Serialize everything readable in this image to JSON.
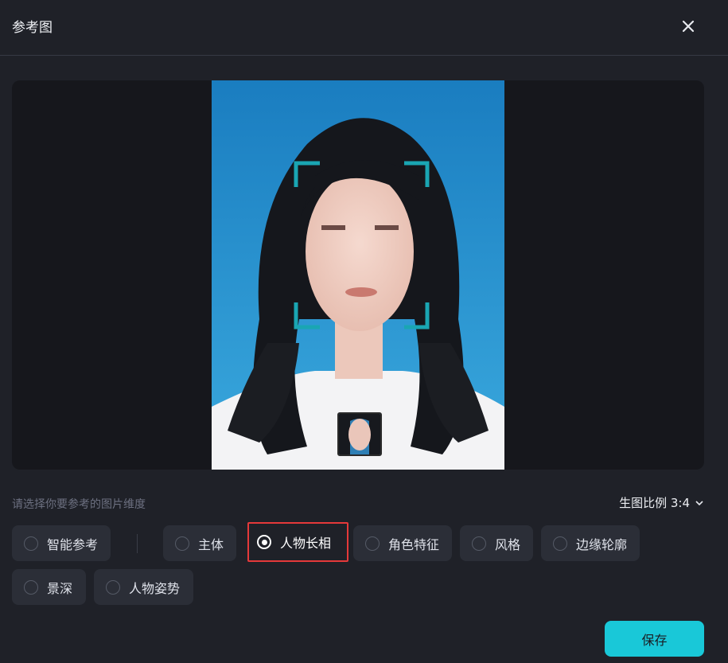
{
  "header": {
    "title": "参考图",
    "close_icon": "close-icon"
  },
  "hint": "请选择你要参考的图片维度",
  "ratio": {
    "label": "生图比例 3:4",
    "icon": "chevron-down-icon"
  },
  "options": [
    {
      "label": "智能参考",
      "selected": false
    },
    {
      "label": "主体",
      "selected": false
    },
    {
      "label": "人物长相",
      "selected": true
    },
    {
      "label": "角色特征",
      "selected": false
    },
    {
      "label": "风格",
      "selected": false
    },
    {
      "label": "边缘轮廓",
      "selected": false
    },
    {
      "label": "景深",
      "selected": false
    },
    {
      "label": "人物姿势",
      "selected": false
    }
  ],
  "save_label": "保存",
  "colors": {
    "accent": "#19c8d8",
    "highlight_border": "#e5393a",
    "face_box": "#1aa6b3",
    "photo_bg": "#1e8ed0"
  }
}
